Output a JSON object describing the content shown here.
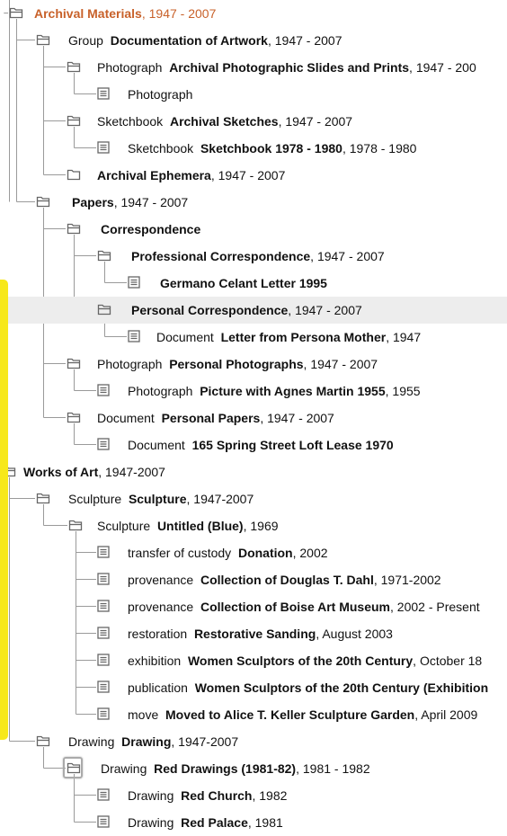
{
  "colors": {
    "accent": "#c8612a",
    "highlight_bar": "#f7e81a",
    "selected_row": "#ededed",
    "lines": "#9a9a9a"
  },
  "icons": {
    "open_folder": "folder-open-icon",
    "closed_folder": "folder-closed-icon",
    "item": "document-icon"
  },
  "nodes": [
    {
      "id": "archival-materials",
      "level": 0,
      "icon": "open",
      "type": "",
      "title": "Archival Materials",
      "date": "1947 - 2007",
      "accent": true
    },
    {
      "id": "documentation-of-artwork",
      "level": 1,
      "icon": "open",
      "type": "Group",
      "title": "Documentation of Artwork",
      "date": "1947 - 2007"
    },
    {
      "id": "archival-photographic-slides",
      "level": 2,
      "icon": "open",
      "type": "Photograph",
      "title": "Archival Photographic Slides and Prints",
      "date": "1947 - 200"
    },
    {
      "id": "photograph-item",
      "level": 3,
      "icon": "item",
      "type": "Photograph",
      "title": "",
      "date": ""
    },
    {
      "id": "archival-sketches",
      "level": 2,
      "icon": "open",
      "type": "Sketchbook",
      "title": "Archival Sketches",
      "date": "1947 - 2007"
    },
    {
      "id": "sketchbook-1978",
      "level": 3,
      "icon": "item",
      "type": "Sketchbook",
      "title": "Sketchbook 1978 - 1980",
      "date": "1978 - 1980"
    },
    {
      "id": "archival-ephemera",
      "level": 2,
      "icon": "closed",
      "type": "",
      "title": "Archival Ephemera",
      "date": "1947 - 2007"
    },
    {
      "id": "papers",
      "level": 1,
      "icon": "open",
      "type": "",
      "title": "Papers",
      "date": "1947 - 2007"
    },
    {
      "id": "correspondence",
      "level": 2,
      "icon": "open",
      "type": "",
      "title": "Correspondence",
      "date": ""
    },
    {
      "id": "professional-correspondence",
      "level": 3,
      "icon": "open",
      "type": "",
      "title": "Professional Correspondence",
      "date": "1947 - 2007"
    },
    {
      "id": "germano-celant-letter",
      "level": 4,
      "icon": "item",
      "type": "",
      "title": "Germano Celant Letter 1995",
      "date": ""
    },
    {
      "id": "personal-correspondence",
      "level": 3,
      "icon": "open",
      "type": "",
      "title": "Personal Correspondence",
      "date": "1947 - 2007",
      "selected": true
    },
    {
      "id": "letter-persona-mother",
      "level": 4,
      "icon": "item",
      "type": "Document",
      "title": "Letter from Persona Mother",
      "date": "1947"
    },
    {
      "id": "personal-photographs",
      "level": 2,
      "icon": "open",
      "type": "Photograph",
      "title": "Personal Photographs",
      "date": "1947 - 2007"
    },
    {
      "id": "picture-agnes-martin",
      "level": 3,
      "icon": "item",
      "type": "Photograph",
      "title": "Picture with Agnes Martin 1955",
      "date": "1955"
    },
    {
      "id": "personal-papers",
      "level": 2,
      "icon": "open",
      "type": "Document",
      "title": "Personal Papers",
      "date": "1947 - 2007"
    },
    {
      "id": "spring-street-lease",
      "level": 3,
      "icon": "item",
      "type": "Document",
      "title": "165 Spring Street Loft Lease 1970",
      "date": ""
    },
    {
      "id": "works-of-art",
      "level": 0,
      "icon": "open",
      "type": "",
      "title": "Works of Art",
      "date": "1947-2007"
    },
    {
      "id": "sculpture-group",
      "level": 1,
      "icon": "open",
      "type": "Sculpture",
      "title": "Sculpture",
      "date": "1947-2007"
    },
    {
      "id": "untitled-blue",
      "level": 2,
      "icon": "open",
      "type": "Sculpture",
      "title": "Untitled (Blue)",
      "date": "1969"
    },
    {
      "id": "donation",
      "level": 3,
      "icon": "item",
      "type": "transfer of custody",
      "title": "Donation",
      "date": "2002"
    },
    {
      "id": "collection-dahl",
      "level": 3,
      "icon": "item",
      "type": "provenance",
      "title": "Collection of Douglas T. Dahl",
      "date": "1971-2002"
    },
    {
      "id": "collection-boise",
      "level": 3,
      "icon": "item",
      "type": "provenance",
      "title": "Collection of Boise Art Museum",
      "date": "2002 - Present"
    },
    {
      "id": "restorative-sanding",
      "level": 3,
      "icon": "item",
      "type": "restoration",
      "title": "Restorative Sanding",
      "date": "August 2003"
    },
    {
      "id": "women-sculptors-exhibition",
      "level": 3,
      "icon": "item",
      "type": "exhibition",
      "title": "Women Sculptors of the 20th Century",
      "date": "October 18"
    },
    {
      "id": "women-sculptors-publication",
      "level": 3,
      "icon": "item",
      "type": "publication",
      "title": "Women Sculptors of the 20th Century (Exhibition",
      "date": ""
    },
    {
      "id": "moved-keller-garden",
      "level": 3,
      "icon": "item",
      "type": "move",
      "title": "Moved to Alice T. Keller Sculpture Garden",
      "date": "April 2009"
    },
    {
      "id": "drawing-group",
      "level": 1,
      "icon": "open",
      "type": "Drawing",
      "title": "Drawing",
      "date": "1947-2007"
    },
    {
      "id": "red-drawings",
      "level": 2,
      "icon": "open",
      "type": "Drawing",
      "title": "Red Drawings (1981-82)",
      "date": "1981 - 1982",
      "focused": true
    },
    {
      "id": "red-church",
      "level": 3,
      "icon": "item",
      "type": "Drawing",
      "title": "Red Church",
      "date": "1982"
    },
    {
      "id": "red-palace",
      "level": 3,
      "icon": "item",
      "type": "Drawing",
      "title": "Red Palace",
      "date": "1981"
    }
  ]
}
